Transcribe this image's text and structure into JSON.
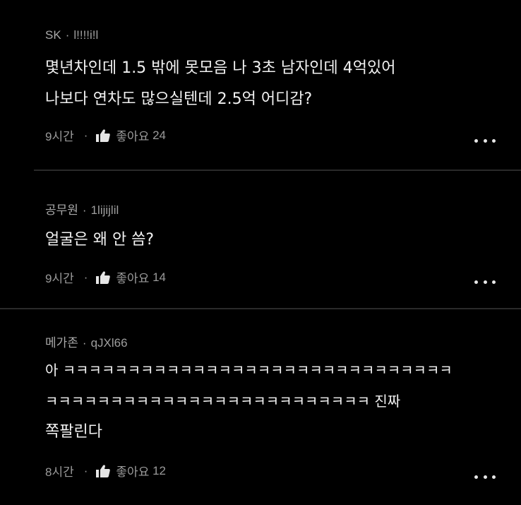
{
  "comments": [
    {
      "author": "SK",
      "user_id": "l!!!!i!l",
      "lines": [
        "몇년차인데 1.5 밖에 못모음 나 3초 남자인데 4억있어",
        "나보다 연차도 많으실텐데 2.5억 어디감?"
      ],
      "time": "9시간",
      "like_label": "좋아요",
      "likes": "24"
    },
    {
      "author": "공무원",
      "user_id": "1lijijlil",
      "lines": [
        "얼굴은 왜 안 씀?"
      ],
      "time": "9시간",
      "like_label": "좋아요",
      "likes": "14"
    },
    {
      "author": "메가존",
      "user_id": "qJXl66",
      "lines": [
        "아 ㅋㅋㅋㅋㅋㅋㅋㅋㅋㅋㅋㅋㅋㅋㅋㅋㅋㅋㅋㅋㅋㅋㅋㅋㅋㅋㅋㅋㅋㅋ",
        "ㅋㅋㅋㅋㅋㅋㅋㅋㅋㅋㅋㅋㅋㅋㅋㅋㅋㅋㅋㅋㅋㅋㅋㅋㅋ 진짜",
        "쪽팔린다"
      ],
      "time": "8시간",
      "like_label": "좋아요",
      "likes": "12"
    }
  ],
  "separator": "·"
}
